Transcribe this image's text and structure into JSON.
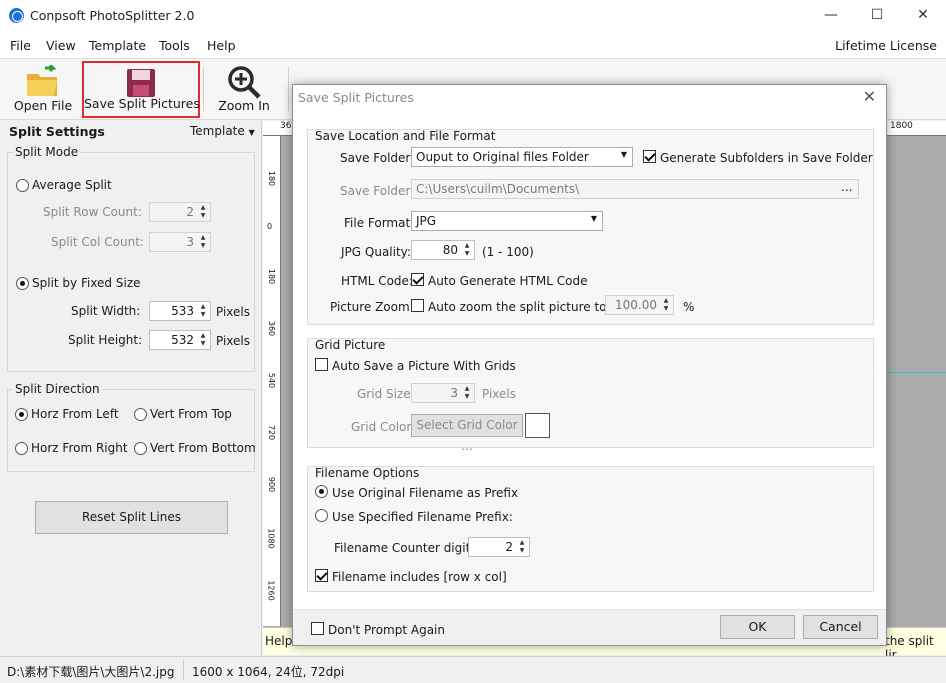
{
  "window": {
    "title": "Conpsoft PhotoSplitter 2.0",
    "minimize": "—",
    "maximize": "☐",
    "close": "✕"
  },
  "menu": {
    "items": [
      "File",
      "View",
      "Template",
      "Tools",
      "Help"
    ],
    "license": "Lifetime License"
  },
  "toolbar": {
    "open_file": "Open File",
    "save_split": "Save Split Pictures",
    "zoom_in": "Zoom In"
  },
  "left_panel": {
    "title": "Split Settings",
    "template": "Template",
    "split_mode": {
      "label": "Split Mode",
      "average": "Average Split",
      "row_count_label": "Split Row Count:",
      "row_count": "2",
      "col_count_label": "Split Col Count:",
      "col_count": "3",
      "fixed": "Split by Fixed Size",
      "width_label": "Split Width:",
      "width": "533",
      "height_label": "Split Height:",
      "height": "532",
      "unit": "Pixels"
    },
    "split_direction": {
      "label": "Split Direction",
      "horz_left": "Horz From Left",
      "vert_top": "Vert From Top",
      "horz_right": "Horz From Right",
      "vert_bottom": "Vert From Bottom"
    },
    "reset_button": "Reset Split Lines"
  },
  "ruler": {
    "h_start": "36",
    "h_end": "1800",
    "v_labels": [
      "180",
      "0",
      "180",
      "360",
      "540",
      "720",
      "900",
      "1080",
      "1260"
    ]
  },
  "helpbar": {
    "left": "Help:",
    "right": "the split lir"
  },
  "status": {
    "path": "D:\\素材下载\\图片\\大图片\\2.jpg",
    "info": "1600 x 1064, 24位, 72dpi"
  },
  "dialog": {
    "title": "Save Split Pictures",
    "location": {
      "label": "Save Location and File Format",
      "save_folder_label": "Save Folder:",
      "save_folder_value": "Ouput to Original files Folder",
      "gen_subfolders": "Generate Subfolders in Save Folder",
      "save_folder2_label": "Save Folder:",
      "save_folder2_value": "C:\\Users\\cuilm\\Documents\\",
      "browse": "...",
      "file_format_label": "File Format:",
      "file_format_value": "JPG",
      "jpg_quality_label": "JPG Quality:",
      "jpg_quality_value": "80",
      "jpg_quality_range": "(1 - 100)",
      "html_code_label": "HTML Code:",
      "html_code_check": "Auto Generate HTML Code",
      "zoom_label": "Picture Zoom:",
      "zoom_check": "Auto zoom the split picture to",
      "zoom_value": "100.00",
      "zoom_unit": "%"
    },
    "grid": {
      "label": "Grid Picture",
      "auto_save": "Auto Save a Picture With Grids",
      "size_label": "Grid Size:",
      "size_value": "3",
      "size_unit": "Pixels",
      "color_label": "Grid Color:",
      "color_button": "Select Grid Color ...",
      "color_value": "#ffffff"
    },
    "filename": {
      "label": "Filename Options",
      "use_original": "Use Original Filename as Prefix",
      "use_specified": "Use Specified Filename Prefix:",
      "counter_label": "Filename Counter digits:",
      "counter_value": "2",
      "includes": "Filename includes [row x col]"
    },
    "dont_prompt": "Don't Prompt Again",
    "ok": "OK",
    "cancel": "Cancel"
  }
}
